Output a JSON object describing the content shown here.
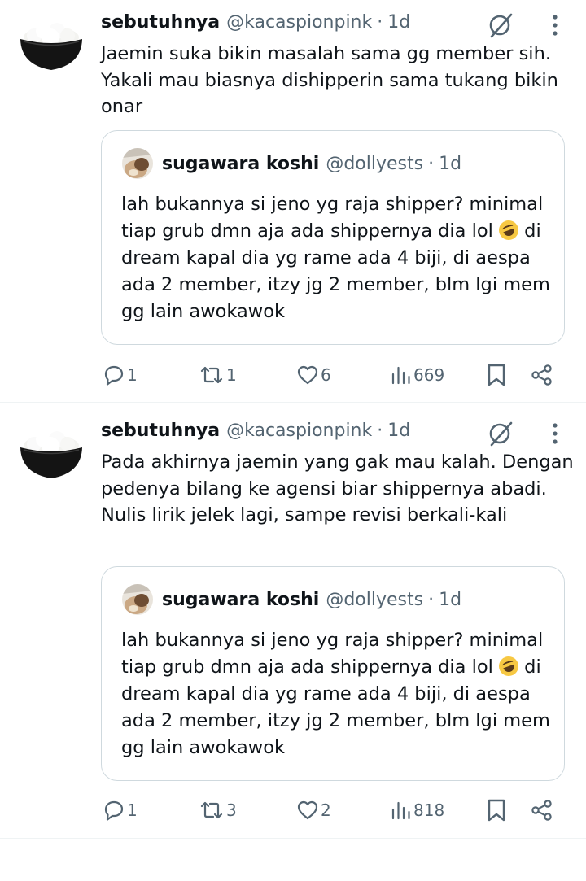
{
  "tweets": [
    {
      "author": "sebutuhnya",
      "handle": "@kacaspionpink",
      "separator": "·",
      "time": "1d",
      "text": "Jaemin suka bikin masalah sama gg member sih. Yakali mau biasnya dishipperin sama tukang bikin onar",
      "quote": {
        "author": "sugawara koshi",
        "handle": "@dollyests",
        "separator": "·",
        "time": "1d",
        "text_before_emoji": "lah bukannya si jeno yg raja shipper? minimal tiap grub dmn aja ada shippernya dia lol ",
        "emoji": "rolling-on-floor-laughing",
        "text_after_emoji": " di dream kapal dia yg rame ada 4 biji, di aespa ada 2 member, itzy jg 2 member, blm lgi mem gg lain awokawok"
      },
      "actions": {
        "replies": "1",
        "reposts": "1",
        "likes": "6",
        "views": "669"
      }
    },
    {
      "author": "sebutuhnya",
      "handle": "@kacaspionpink",
      "separator": "·",
      "time": "1d",
      "text": "Pada akhirnya jaemin yang gak mau kalah. Dengan pedenya bilang ke agensi biar shippernya abadi. Nulis lirik jelek lagi, sampe revisi berkali-kali",
      "quote": {
        "author": "sugawara koshi",
        "handle": "@dollyests",
        "separator": "·",
        "time": "1d",
        "text_before_emoji": "lah bukannya si jeno yg raja shipper? minimal tiap grub dmn aja ada shippernya dia lol ",
        "emoji": "rolling-on-floor-laughing",
        "text_after_emoji": " di dream kapal dia yg rame ada 4 biji, di aespa ada 2 member, itzy jg 2 member, blm lgi mem gg lain awokawok"
      },
      "actions": {
        "replies": "1",
        "reposts": "3",
        "likes": "2",
        "views": "818"
      }
    }
  ],
  "icons": {
    "reply": "reply-icon",
    "repost": "repost-icon",
    "like": "heart-icon",
    "views": "views-icon",
    "bookmark": "bookmark-icon",
    "share": "share-icon",
    "grok": "grok-icon",
    "more": "more-icon"
  },
  "colors": {
    "text": "#0f1419",
    "secondary": "#536471",
    "border": "#cfd9de",
    "divider": "#eff3f4"
  }
}
